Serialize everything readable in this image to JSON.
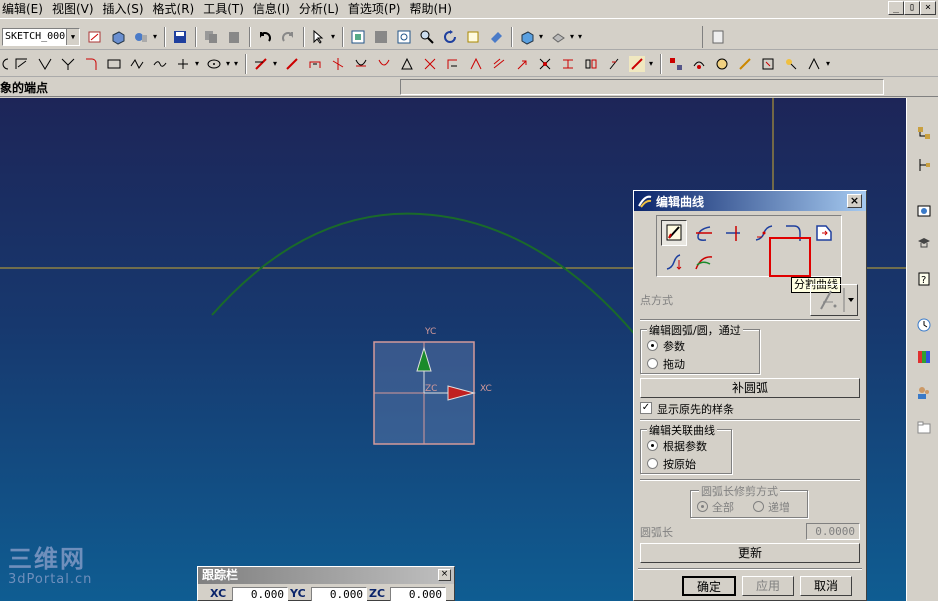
{
  "menubar": {
    "items": [
      "编辑(E)",
      "视图(V)",
      "插入(S)",
      "格式(R)",
      "工具(T)",
      "信息(I)",
      "分析(L)",
      "首选项(P)",
      "帮助(H)"
    ],
    "window_controls": [
      "_",
      "▯",
      "×"
    ]
  },
  "toolbar": {
    "sketch_combo_value": "SKETCH_000"
  },
  "prompt": {
    "text": "象的端点"
  },
  "viewport": {
    "axis_labels": {
      "yc": "YC",
      "xc": "XC",
      "zc": "ZC"
    },
    "watermark": {
      "line1": "三维网",
      "line2": "3dPortal.cn"
    }
  },
  "edit_curve_dialog": {
    "title": "编辑曲线",
    "close_label": "×",
    "tooltip": "分割曲线",
    "point_method_label": "点方式",
    "arc_group_title": "编辑圆弧/圆，通过",
    "arc_options": [
      "参数",
      "拖动"
    ],
    "supplement_arc_button": "补圆弧",
    "show_original_spline_label": "显示原先的样条",
    "associated_group_title": "编辑关联曲线",
    "associated_options": [
      "根据参数",
      "按原始"
    ],
    "arc_trim_group_title": "圆弧长修剪方式",
    "arc_trim_options": [
      "全部",
      "递增"
    ],
    "arc_length_label": "圆弧长",
    "arc_length_value": "0.0000",
    "update_button": "更新",
    "ok_button": "确定",
    "apply_button": "应用",
    "cancel_button": "取消"
  },
  "tracking_bar": {
    "title": "跟踪栏",
    "close_label": "×",
    "fields": [
      {
        "label": "XC",
        "value": "0.000"
      },
      {
        "label": "YC",
        "value": "0.000"
      },
      {
        "label": "ZC",
        "value": "0.000"
      }
    ]
  },
  "colors": {
    "accent_highlight": "#e00000",
    "curve": "#1a6a2a",
    "crosshair": "#c8a830"
  }
}
